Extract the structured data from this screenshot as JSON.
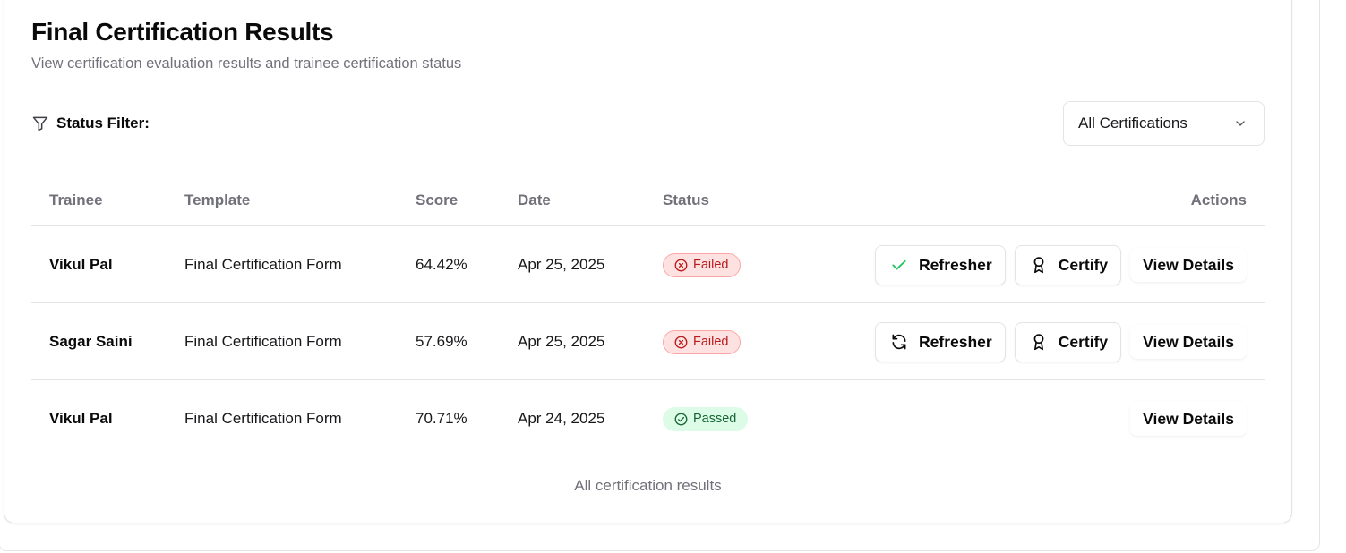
{
  "header": {
    "title": "Final Certification Results",
    "subtitle": "View certification evaluation results and trainee certification status"
  },
  "filter": {
    "label": "Status Filter:",
    "icon": "filter-icon",
    "selected": "All Certifications"
  },
  "table": {
    "columns": [
      "Trainee",
      "Template",
      "Score",
      "Date",
      "Status",
      "Actions"
    ],
    "rows": [
      {
        "trainee": "Vikul Pal",
        "template": "Final Certification Form",
        "score": "64.42%",
        "date": "Apr 25, 2025",
        "status": "Failed",
        "actions": {
          "refresher": "Refresher",
          "refresher_icon": "check-icon",
          "certify": "Certify",
          "details": "View Details"
        }
      },
      {
        "trainee": "Sagar Saini",
        "template": "Final Certification Form",
        "score": "57.69%",
        "date": "Apr 25, 2025",
        "status": "Failed",
        "actions": {
          "refresher": "Refresher",
          "refresher_icon": "refresh-icon",
          "certify": "Certify",
          "details": "View Details"
        }
      },
      {
        "trainee": "Vikul Pal",
        "template": "Final Certification Form",
        "score": "70.71%",
        "date": "Apr 24, 2025",
        "status": "Passed",
        "actions": {
          "details": "View Details"
        }
      }
    ],
    "caption": "All certification results"
  },
  "colors": {
    "failed_bg": "#fee2e2",
    "failed_text": "#b91c1c",
    "passed_bg": "#dcfce7",
    "passed_text": "#166534",
    "check_green": "#22c55e",
    "muted_text": "#71717a",
    "border": "#e4e4e7"
  }
}
